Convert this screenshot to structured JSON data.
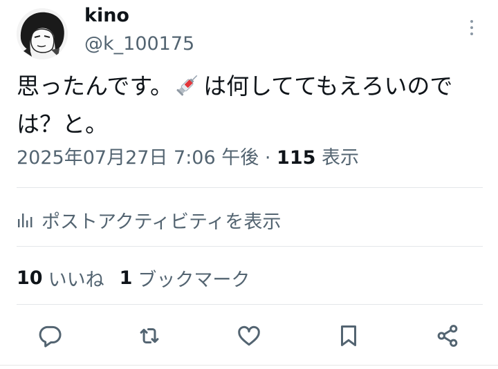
{
  "user": {
    "display_name": "kino",
    "handle": "@k_100175"
  },
  "tweet": {
    "text_before": "思ったんです。",
    "text_after": "は何しててもえろいのでは？と。",
    "emoji_icon": "syringe-icon"
  },
  "meta": {
    "date": "2025年07月27日",
    "time": "7:06 午後",
    "separator": "·",
    "view_count": "115",
    "view_label": "表示"
  },
  "activity": {
    "label": "ポストアクティビティを表示",
    "icon": "analytics-icon"
  },
  "stats": {
    "likes_count": "10",
    "likes_label": "いいね",
    "bookmarks_count": "1",
    "bookmarks_label": "ブックマーク"
  },
  "actions": [
    "reply-icon",
    "repost-icon",
    "like-icon",
    "bookmark-icon",
    "share-icon"
  ],
  "colors": {
    "primary_text": "#0f1419",
    "secondary_text": "#536471",
    "icon": "#536471",
    "divider": "#e3e6e9"
  }
}
